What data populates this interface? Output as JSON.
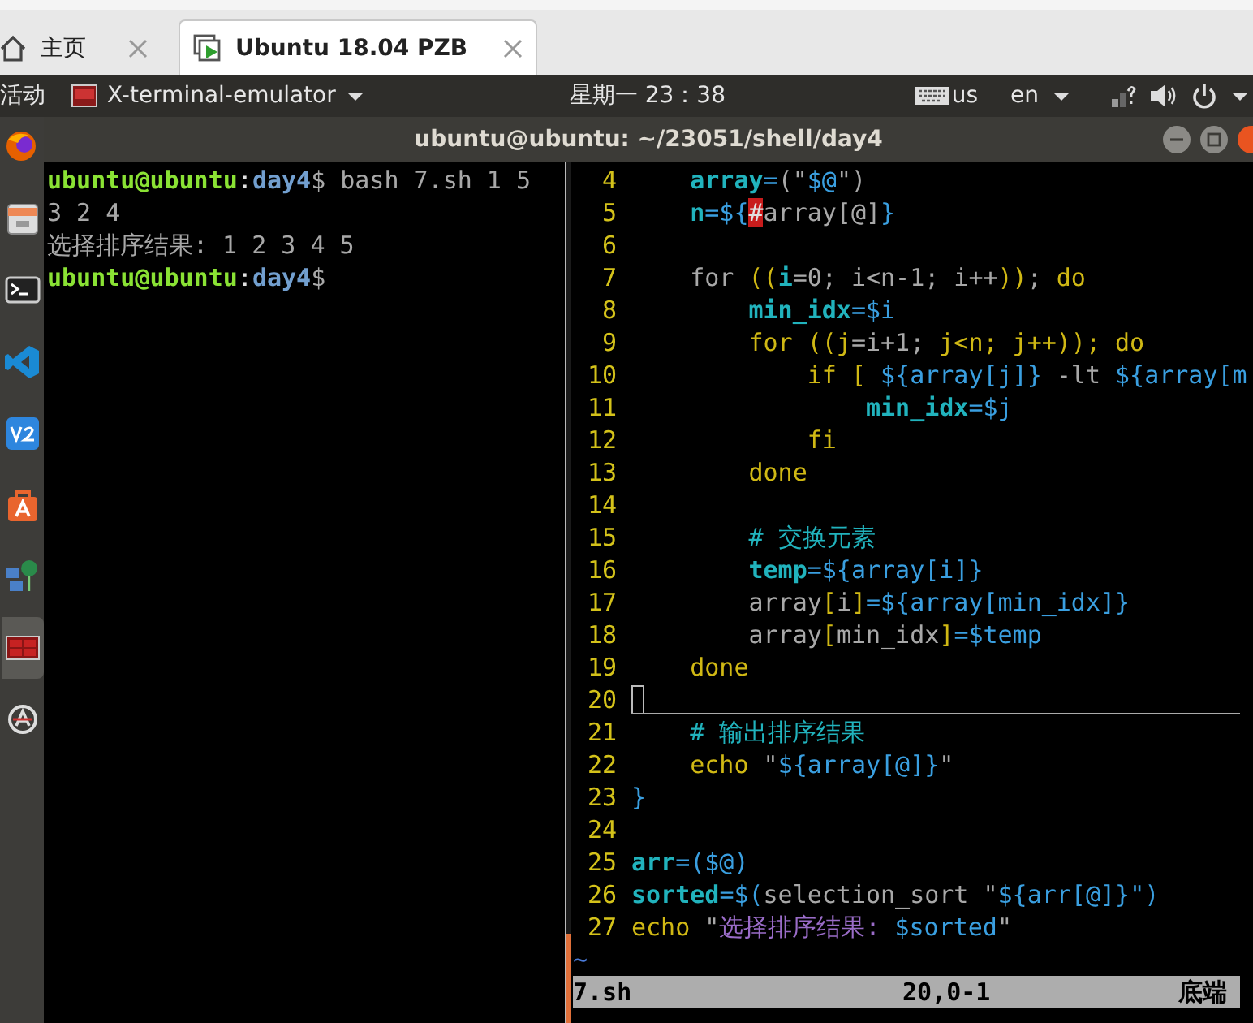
{
  "browser_tabs": [
    {
      "label": "主页",
      "selected": false,
      "kind": "home"
    },
    {
      "label": "Ubuntu 18.04 PZB",
      "selected": true,
      "kind": "vm"
    }
  ],
  "top_bar": {
    "activities": "活动",
    "app_menu": "X-terminal-emulator",
    "clock": "星期一 23：38",
    "keyboard": "us",
    "language": "en"
  },
  "dock": {
    "items": [
      {
        "kind": "firefox",
        "selected": false
      },
      {
        "kind": "files",
        "selected": false
      },
      {
        "kind": "terminal",
        "selected": false
      },
      {
        "kind": "vscode",
        "selected": false
      },
      {
        "kind": "editor",
        "selected": false
      },
      {
        "kind": "store",
        "selected": false
      },
      {
        "kind": "network",
        "selected": false
      },
      {
        "kind": "xterm",
        "selected": true
      },
      {
        "kind": "updater",
        "selected": false
      }
    ]
  },
  "window": {
    "title": "ubuntu@ubuntu: ~/23051/shell/day4"
  },
  "shell_pane": {
    "lines": [
      {
        "tokens": [
          {
            "t": "ubuntu@ubuntu",
            "kind": "user"
          },
          {
            "t": ":",
            "kind": "white"
          },
          {
            "t": "day4",
            "kind": "dir"
          },
          {
            "t": "$ bash 7.sh 1 5",
            "kind": "plain"
          }
        ]
      },
      {
        "tokens": [
          {
            "t": "3 2 4",
            "kind": "plain"
          }
        ]
      },
      {
        "tokens": [
          {
            "t": "选择排序结果: 1 2 3 4 5",
            "kind": "plain"
          }
        ]
      },
      {
        "tokens": [
          {
            "t": "ubuntu@ubuntu",
            "kind": "user"
          },
          {
            "t": ":",
            "kind": "white"
          },
          {
            "t": "day4",
            "kind": "dir"
          },
          {
            "t": "$",
            "kind": "plain"
          }
        ]
      }
    ]
  },
  "editor": {
    "lines": [
      {
        "number": "4",
        "cursor": false,
        "tokens": [
          {
            "t": "    array",
            "kind": "var"
          },
          {
            "t": "=",
            "kind": "op"
          },
          {
            "t": "(\"",
            "kind": "plain"
          },
          {
            "t": "$@",
            "kind": "op"
          },
          {
            "t": "\")",
            "kind": "plain"
          }
        ]
      },
      {
        "number": "5",
        "cursor": false,
        "tokens": [
          {
            "t": "    n",
            "kind": "var"
          },
          {
            "t": "=${",
            "kind": "op"
          },
          {
            "t": "#",
            "kind": "hl"
          },
          {
            "t": "array[@]",
            "kind": "plain"
          },
          {
            "t": "}",
            "kind": "op"
          }
        ]
      },
      {
        "number": "6",
        "cursor": false
      },
      {
        "number": "7",
        "cursor": false,
        "tokens": [
          {
            "t": "    for ",
            "kind": "plain"
          },
          {
            "t": "((",
            "kind": "kw"
          },
          {
            "t": "i",
            "kind": "var"
          },
          {
            "t": "=0; i<n-1; i++",
            "kind": "plain"
          },
          {
            "t": "))",
            "kind": "kw"
          },
          {
            "t": "; ",
            "kind": "plain"
          },
          {
            "t": "do",
            "kind": "kw"
          }
        ]
      },
      {
        "number": "8",
        "cursor": false,
        "tokens": [
          {
            "t": "        min_idx",
            "kind": "var"
          },
          {
            "t": "=$i",
            "kind": "op"
          }
        ]
      },
      {
        "number": "9",
        "cursor": false,
        "tokens": [
          {
            "t": "        for ((j",
            "kind": "kw"
          },
          {
            "t": "=i+1; ",
            "kind": "plain"
          },
          {
            "t": "j<n; j++)); do",
            "kind": "kw"
          }
        ]
      },
      {
        "number": "10",
        "cursor": false,
        "tokens": [
          {
            "t": "            if [ ",
            "kind": "kw"
          },
          {
            "t": "${array[j]}",
            "kind": "op"
          },
          {
            "t": " -lt ",
            "kind": "plain"
          },
          {
            "t": "${array[m",
            "kind": "op"
          }
        ]
      },
      {
        "number": "11",
        "cursor": false,
        "tokens": [
          {
            "t": "                min_idx",
            "kind": "var"
          },
          {
            "t": "=$j",
            "kind": "op"
          }
        ]
      },
      {
        "number": "12",
        "cursor": false,
        "tokens": [
          {
            "t": "            fi",
            "kind": "kw"
          }
        ]
      },
      {
        "number": "13",
        "cursor": false,
        "tokens": [
          {
            "t": "        done",
            "kind": "kw"
          }
        ]
      },
      {
        "number": "14",
        "cursor": false
      },
      {
        "number": "15",
        "cursor": false,
        "tokens": [
          {
            "t": "        # 交换元素",
            "kind": "com"
          }
        ]
      },
      {
        "number": "16",
        "cursor": false,
        "tokens": [
          {
            "t": "        temp",
            "kind": "var"
          },
          {
            "t": "=${array[i]}",
            "kind": "op"
          }
        ]
      },
      {
        "number": "17",
        "cursor": false,
        "tokens": [
          {
            "t": "        array",
            "kind": "plain"
          },
          {
            "t": "[",
            "kind": "kw"
          },
          {
            "t": "i",
            "kind": "plain"
          },
          {
            "t": "]",
            "kind": "kw"
          },
          {
            "t": "=${array[min_idx]}",
            "kind": "op"
          }
        ]
      },
      {
        "number": "18",
        "cursor": false,
        "tokens": [
          {
            "t": "        array",
            "kind": "plain"
          },
          {
            "t": "[",
            "kind": "kw"
          },
          {
            "t": "min_idx",
            "kind": "plain"
          },
          {
            "t": "]",
            "kind": "kw"
          },
          {
            "t": "=$temp",
            "kind": "op"
          }
        ]
      },
      {
        "number": "19",
        "cursor": false,
        "tokens": [
          {
            "t": "    done",
            "kind": "kw"
          }
        ]
      },
      {
        "number": "20",
        "cursor": true
      },
      {
        "number": "21",
        "cursor": false,
        "tokens": [
          {
            "t": "    # 输出排序结果",
            "kind": "com"
          }
        ]
      },
      {
        "number": "22",
        "cursor": false,
        "tokens": [
          {
            "t": "    echo ",
            "kind": "kw"
          },
          {
            "t": "\"",
            "kind": "plain"
          },
          {
            "t": "${array[@]}",
            "kind": "op"
          },
          {
            "t": "\"",
            "kind": "plain"
          }
        ]
      },
      {
        "number": "23",
        "cursor": false,
        "tokens": [
          {
            "t": "}",
            "kind": "op"
          }
        ]
      },
      {
        "number": "24",
        "cursor": false
      },
      {
        "number": "25",
        "cursor": false,
        "tokens": [
          {
            "t": "arr",
            "kind": "var"
          },
          {
            "t": "=($@)",
            "kind": "op"
          }
        ]
      },
      {
        "number": "26",
        "cursor": false,
        "tokens": [
          {
            "t": "sorted",
            "kind": "var"
          },
          {
            "t": "=$(",
            "kind": "op"
          },
          {
            "t": "selection_sort \"",
            "kind": "plain"
          },
          {
            "t": "${arr[@]}",
            "kind": "op"
          },
          {
            "t": "\")",
            "kind": "op"
          }
        ]
      },
      {
        "number": "27",
        "cursor": false,
        "tokens": [
          {
            "t": "echo ",
            "kind": "kw"
          },
          {
            "t": "\"",
            "kind": "plain"
          },
          {
            "t": "选择排序结果: ",
            "kind": "str"
          },
          {
            "t": "$sorted",
            "kind": "op"
          },
          {
            "t": "\"",
            "kind": "plain"
          }
        ]
      }
    ],
    "tildes": [
      "~"
    ],
    "status": {
      "file": "7.sh",
      "position": "20,0-1",
      "scroll": "底端"
    }
  }
}
